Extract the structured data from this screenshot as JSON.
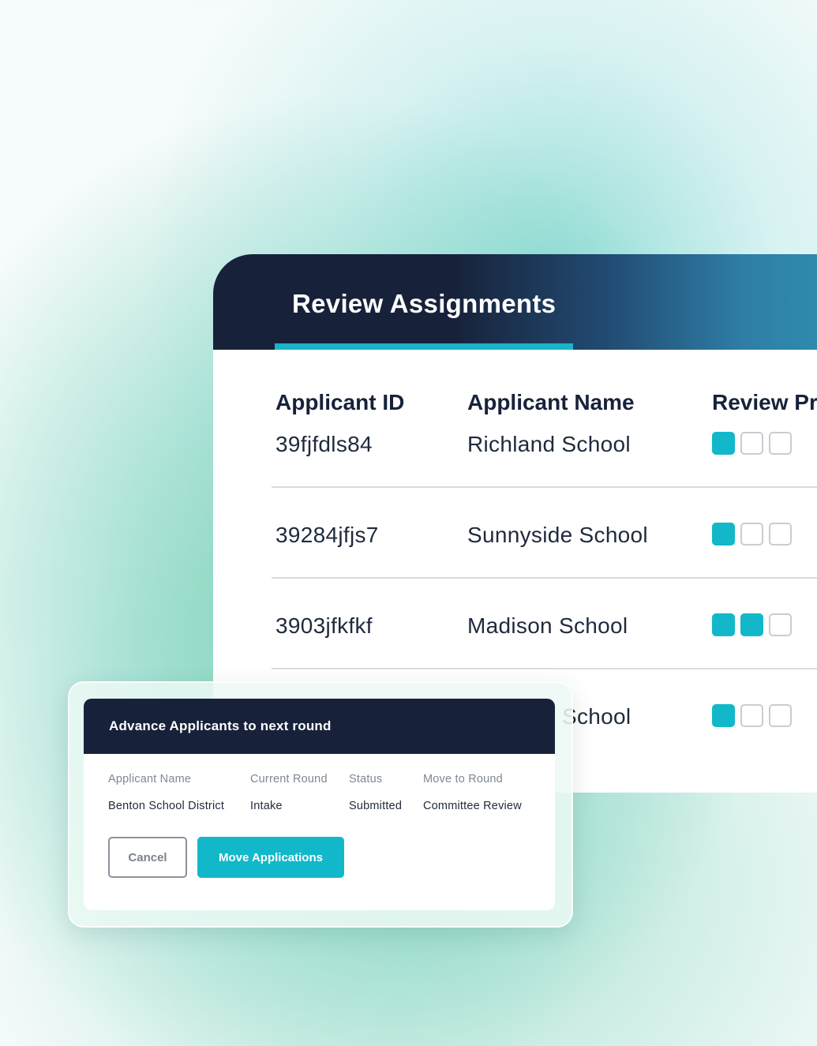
{
  "review": {
    "title": "Review Assignments",
    "columns": [
      "Applicant ID",
      "Applicant Name",
      "Review Pr"
    ],
    "rows": [
      {
        "id": "39fjfdls84",
        "name": "Richland School",
        "progress": [
          true,
          false,
          false
        ]
      },
      {
        "id": "39284jfjs7",
        "name": "Sunnyside School",
        "progress": [
          true,
          false,
          false
        ]
      },
      {
        "id": "3903jfkfkf",
        "name": "Madison School",
        "progress": [
          true,
          true,
          false
        ]
      },
      {
        "id": "",
        "name": "School",
        "progress": [
          true,
          false,
          false
        ]
      }
    ]
  },
  "modal": {
    "title": "Advance Applicants to next round",
    "headers": [
      "Applicant Name",
      "Current Round",
      "Status",
      "Move to Round"
    ],
    "values": [
      "Benton School District",
      "Intake",
      "Submitted",
      "Committee Review"
    ],
    "cancel_label": "Cancel",
    "move_label": "Move Applications"
  },
  "colors": {
    "accent": "#12b8c9",
    "header_dark": "#17223a"
  }
}
